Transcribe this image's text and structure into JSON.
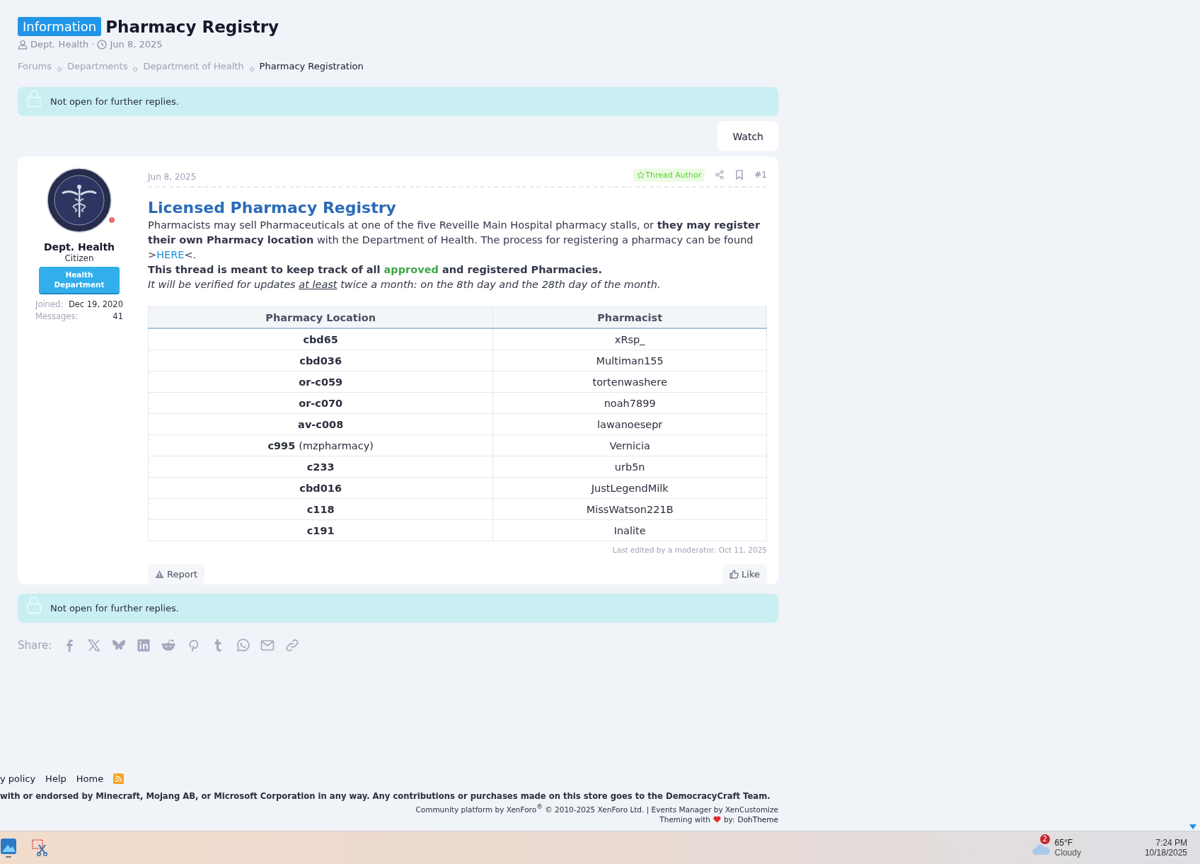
{
  "thread": {
    "prefix": "Information",
    "title": "Pharmacy Registry",
    "author": "Dept. Health",
    "date": "Jun 8, 2025",
    "separator": "·"
  },
  "breadcrumbs": [
    {
      "label": "Forums",
      "current": false
    },
    {
      "label": "Departments",
      "current": false
    },
    {
      "label": "Department of Health",
      "current": false
    },
    {
      "label": "Pharmacy Registration",
      "current": true
    }
  ],
  "notice_top": "Not open for further replies.",
  "watch_button": "Watch",
  "post": {
    "user": {
      "name": "Dept. Health",
      "title": "Citizen",
      "banner": "Health Department",
      "stats": [
        {
          "label": "Joined:",
          "value": "Dec 19, 2020"
        },
        {
          "label": "Messages:",
          "value": "41"
        }
      ]
    },
    "date": "Jun 8, 2025",
    "author_badge": "Thread Author",
    "number": "#1",
    "heading": "Licensed Pharmacy Registry",
    "intro": {
      "text": "Pharmacists may sell Pharmaceuticals at one of the five Reveille Main Hospital pharmacy stalls, or **they may register their own Pharmacy location** with the Department of Health. The process for registering a pharmacy can be found >",
      "link": "HERE",
      "after": "<."
    },
    "tracking": {
      "before": "This thread is meant to keep track of all",
      "highlight": "approved",
      "after": "and registered Pharmacies."
    },
    "schedule": {
      "before": "It will be verified for updates",
      "underlined": "at least",
      "after": "twice a month: on the 8th day and the 28th day of the month."
    },
    "table": {
      "columns": [
        "Pharmacy Location",
        "Pharmacist"
      ],
      "rows": [
        {
          "location": "cbd65",
          "pharmacist": "xRsp_"
        },
        {
          "location": "cbd036",
          "pharmacist": "Multiman155"
        },
        {
          "location": "or-c059",
          "pharmacist": "tortenwashere"
        },
        {
          "location": "or-c070",
          "pharmacist": "noah7899"
        },
        {
          "location": "av-c008",
          "pharmacist": "lawanoesepr"
        },
        {
          "location": "c995",
          "note": "(mzpharmacy)",
          "pharmacist": "Vernicia"
        },
        {
          "location": "c233",
          "pharmacist": "urb5n"
        },
        {
          "location": "cbd016",
          "pharmacist": "JustLegendMilk"
        },
        {
          "location": "c118",
          "pharmacist": "MissWatson221B"
        },
        {
          "location": "c191",
          "pharmacist": "Inalite"
        }
      ]
    },
    "edited": "Last edited by a moderator: Oct 11, 2025",
    "report_button": "Report",
    "like_button": "Like"
  },
  "notice_bottom": "Not open for further replies.",
  "share": {
    "label": "Share:"
  },
  "footer": {
    "links": [
      "y policy",
      "Help",
      "Home"
    ],
    "disclaimer": "with or endorsed by Minecraft, Mojang AB, or Microsoft Corporation in any way. Any contributions or purchases made on this store goes to the DemocracyCraft Team.",
    "credit": "Community platform by XenForo$^{®}$ © 2010-2025 XenForo Ltd. | Events Manager by XenCustomize",
    "theming": {
      "before": "Theming with",
      "after": "by:",
      "link": "DohTheme"
    }
  },
  "taskbar": {
    "weather": {
      "badge": "2",
      "temperature": "65°F",
      "condition": "Cloudy"
    },
    "time": "7:24 PM",
    "date": "10/18/2025"
  }
}
